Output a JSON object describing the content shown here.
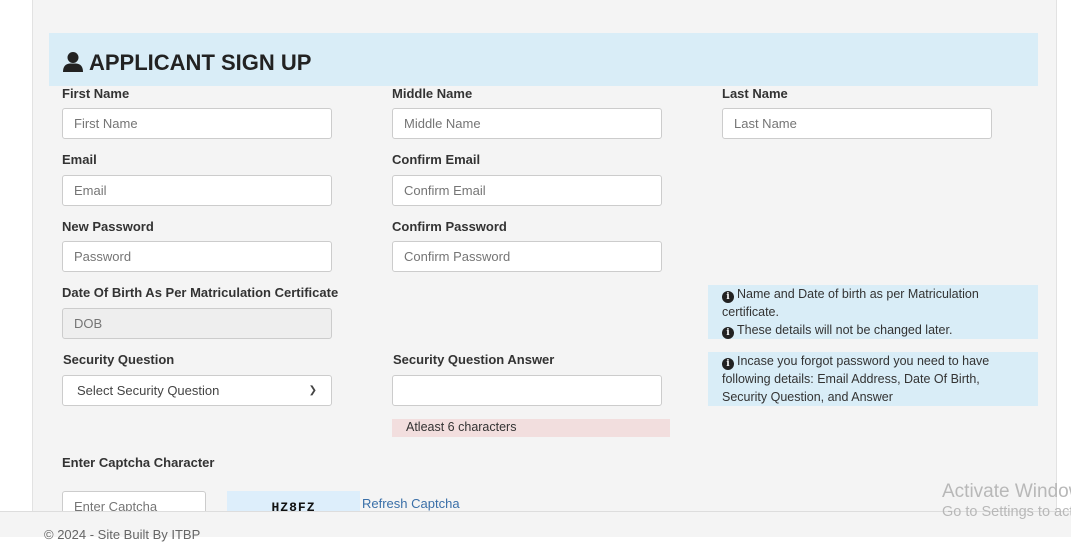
{
  "header": {
    "title": "APPLICANT SIGN UP",
    "icon": "user-icon"
  },
  "form": {
    "first_name": {
      "label": "First Name",
      "placeholder": "First Name",
      "value": ""
    },
    "middle_name": {
      "label": "Middle Name",
      "placeholder": "Middle Name",
      "value": ""
    },
    "last_name": {
      "label": "Last Name",
      "placeholder": "Last Name",
      "value": ""
    },
    "email": {
      "label": "Email",
      "placeholder": "Email",
      "value": ""
    },
    "confirm_email": {
      "label": "Confirm Email",
      "placeholder": "Confirm Email",
      "value": ""
    },
    "new_password": {
      "label": "New Password",
      "placeholder": "Password",
      "value": ""
    },
    "confirm_password": {
      "label": "Confirm Password",
      "placeholder": "Confirm Password",
      "value": ""
    },
    "dob": {
      "label": "Date Of Birth As Per Matriculation Certificate",
      "placeholder": "DOB",
      "value": "",
      "disabled": true
    },
    "security_question": {
      "label": "Security Question",
      "selected": "Select Security Question"
    },
    "security_answer": {
      "label": "Security Question Answer",
      "placeholder": "",
      "value": "",
      "hint": "Atleast 6 characters"
    },
    "captcha": {
      "label": "Enter Captcha Character",
      "placeholder": "Enter Captcha",
      "value": "",
      "image_text": "HZ8FZ",
      "refresh_label": "Refresh Captcha"
    }
  },
  "info_boxes": {
    "dob_note": {
      "line1": "Name and Date of birth as per Matriculation certificate.",
      "line2": "These details will not be changed later."
    },
    "password_note": {
      "line1": "Incase you forgot password you need to have following details: Email Address, Date Of Birth, Security Question, and Answer"
    }
  },
  "footer": {
    "text": "© 2024 - Site Built By ITBP"
  },
  "watermark": {
    "line1": "Activate Windows",
    "line2": "Go to Settings to activate Windows."
  }
}
